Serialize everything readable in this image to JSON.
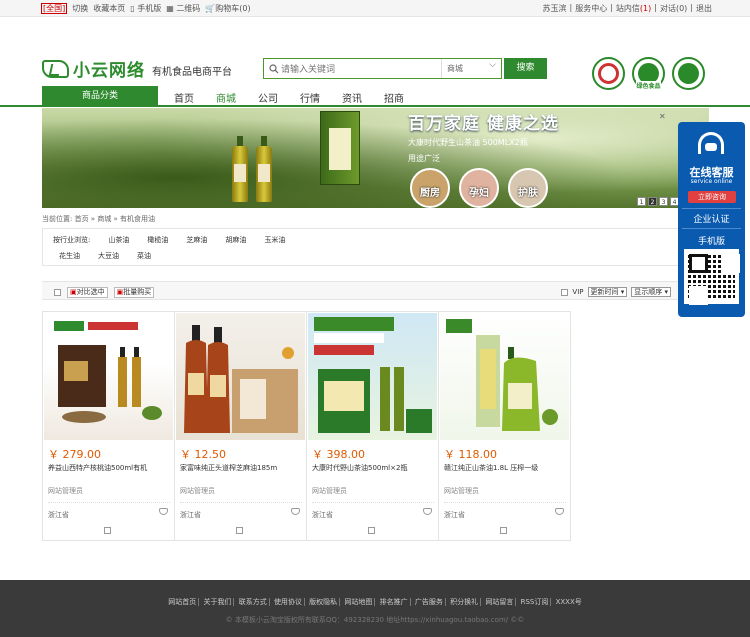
{
  "topbar": {
    "region": "[全国]",
    "switch": "切换",
    "favorite": "收藏本页",
    "mobile": "手机版",
    "qrcode": "二维码",
    "cart": "购物车(0)",
    "user": "苏玉滨",
    "service_center": "服务中心",
    "inbox": "站内信",
    "inbox_count": "(1)",
    "notifications": "对话(0)",
    "logout": "退出"
  },
  "header": {
    "logo_text": "小云网络",
    "slogan": "有机食品电商平台",
    "search_placeholder": "请输入关键词",
    "search_scope": "商城",
    "search_button": "搜索",
    "badge_label": "绿色食品"
  },
  "nav": {
    "category_button": "商品分类",
    "items": [
      {
        "label": "首页"
      },
      {
        "label": "商城"
      },
      {
        "label": "公司"
      },
      {
        "label": "行情"
      },
      {
        "label": "资讯"
      },
      {
        "label": "招商"
      }
    ]
  },
  "banner": {
    "title": "百万家庭  健康之选",
    "subtitle": "大康时代野生山茶油    500MLX2瓶",
    "subtitle2": "用途广泛",
    "circles": [
      "厨房",
      "孕妇",
      "护肤"
    ],
    "pager": [
      "1",
      "2",
      "3",
      "4",
      "5",
      "6"
    ]
  },
  "breadcrumb": "当前位置: 首页 » 商城 » 有机食用油",
  "filter": {
    "label": "按行业浏览:",
    "row1": [
      "山茶油",
      "橄榄油",
      "芝麻油",
      "胡麻油",
      "玉米油"
    ],
    "row2": [
      "花生油",
      "大豆油",
      "菜油"
    ]
  },
  "sortbar": {
    "compare": "对比选中",
    "batch_buy": "批量购买",
    "vip": "VIP",
    "sort_time": "更新时间",
    "sort_order": "显示顺序"
  },
  "products": [
    {
      "price": "￥ 279.00",
      "name": "养益山西特产核桃油500ml有机",
      "seller": "网站管理员",
      "province": "浙江省"
    },
    {
      "price": "￥ 12.50",
      "name": "家富味纯正头道榨芝麻油185m",
      "seller": "网站管理员",
      "province": "浙江省"
    },
    {
      "price": "￥ 398.00",
      "name": "大康时代野山茶油500ml×2瓶",
      "seller": "网站管理员",
      "province": "浙江省"
    },
    {
      "price": "￥ 118.00",
      "name": "赣江纯正山茶油1.8L 压榨一级",
      "seller": "网站管理员",
      "province": "浙江省"
    }
  ],
  "footer": {
    "links": [
      "网站首页",
      "关于我们",
      "联系方式",
      "使用协议",
      "版权隐私",
      "网站地图",
      "排名推广",
      "广告服务",
      "积分换礼",
      "网站留言",
      "RSS订阅",
      "XXXX号"
    ],
    "copyright": "© 本模板小云淘宝版权所有联系QQ：492328230 地址https://xinhuagou.taobao.com/ ©©"
  },
  "service": {
    "title": "在线客服",
    "subtitle": "service online",
    "consult": "立即咨询",
    "certification": "企业认证",
    "mobile": "手机版"
  },
  "colors": {
    "brand_green": "#2f8a2f",
    "price_orange": "#e05a00",
    "service_blue": "#0a5bb0"
  }
}
